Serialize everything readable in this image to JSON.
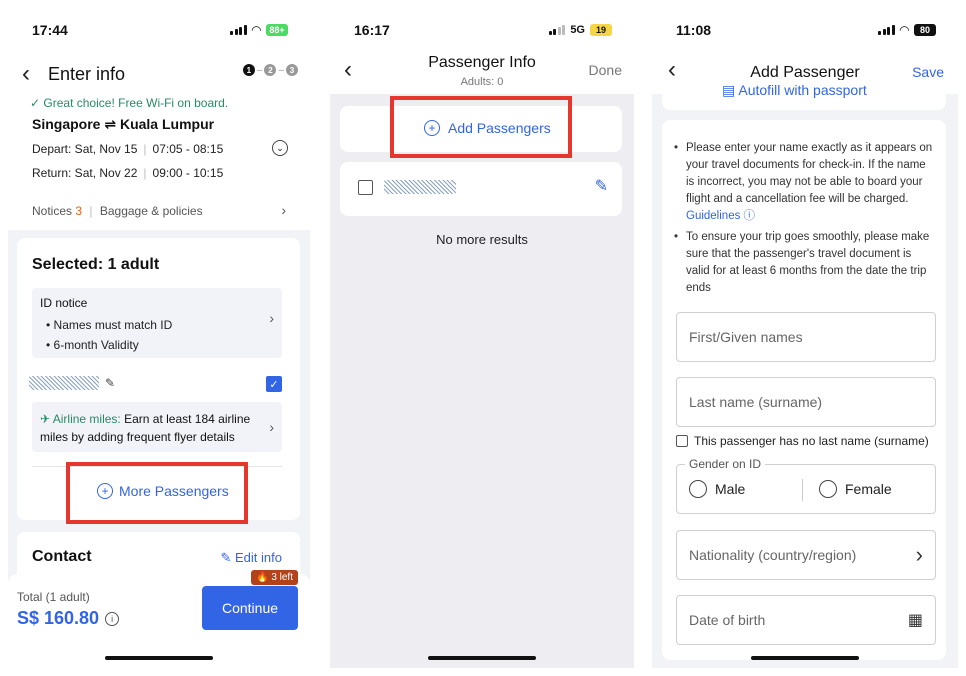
{
  "colors": {
    "accent": "#3264e6",
    "success": "#2a8a65",
    "highlight": "#e6372f",
    "warning": "#e2621b"
  },
  "screen1": {
    "status": {
      "time": "17:44",
      "battery": "88+"
    },
    "header": {
      "title": "Enter info",
      "steps": [
        "1",
        "2",
        "3"
      ]
    },
    "wifi_note": "Great choice! Free Wi-Fi on board.",
    "route": "Singapore ⇌ Kuala Lumpur",
    "depart": {
      "label": "Depart: Sat, Nov 15",
      "time": "07:05 - 08:15"
    },
    "return": {
      "label": "Return: Sat, Nov 22",
      "time": "09:00 - 10:15"
    },
    "notices": {
      "label": "Notices",
      "count": "3",
      "separator": "|",
      "policies": "Baggage & policies"
    },
    "selected_title": "Selected: 1 adult",
    "id_notice": {
      "title": "ID notice",
      "items": [
        "Names must match ID",
        "6-month Validity"
      ]
    },
    "miles": {
      "label": "Airline miles:",
      "text": "Earn at least 184 airline miles by adding frequent flyer details"
    },
    "more_passengers": "More Passengers",
    "contact": {
      "title": "Contact",
      "edit": "Edit info"
    },
    "footer": {
      "total_label": "Total (1 adult)",
      "total_amount": "S$ 160.80",
      "continue": "Continue",
      "left_badge": "3 left"
    }
  },
  "screen2": {
    "status": {
      "time": "16:17",
      "network": "5G",
      "battery": "19"
    },
    "header": {
      "title": "Passenger Info",
      "subtitle": "Adults: 0",
      "done": "Done"
    },
    "add_passengers": "Add Passengers",
    "no_more": "No more results"
  },
  "screen3": {
    "status": {
      "time": "11:08",
      "battery": "80"
    },
    "header": {
      "title": "Add Passenger",
      "save": "Save"
    },
    "autofill": "Autofill with passport",
    "notes": {
      "n1": "Please enter your name exactly as it appears on your travel documents for check-in. If the name is incorrect, you may not be able to board your flight and a cancellation fee will be charged.",
      "guidelines": "Guidelines",
      "n2": "To ensure your trip goes smoothly, please make sure that the passenger's travel document is valid for at least 6 months from the date the trip ends"
    },
    "fields": {
      "first": "First/Given names",
      "last": "Last name (surname)",
      "no_last": "This passenger has no last name (surname)",
      "gender_label": "Gender on ID",
      "male": "Male",
      "female": "Female",
      "nationality": "Nationality (country/region)",
      "dob": "Date of birth"
    }
  }
}
